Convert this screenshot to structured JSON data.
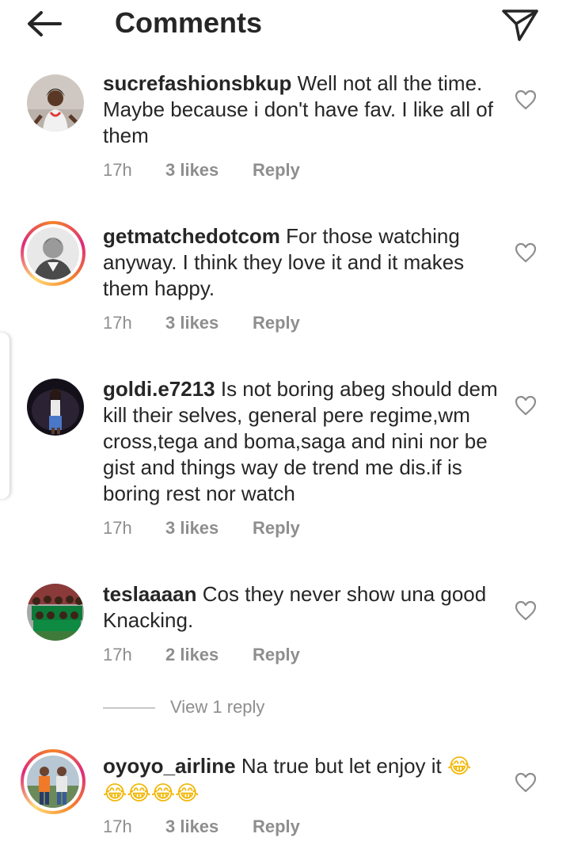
{
  "header": {
    "title": "Comments"
  },
  "comments": [
    {
      "username": "sucrefashionsbkup",
      "text": "Well not all the time. Maybe because i don't have fav. I like all of them",
      "time": "17h",
      "likes": "3 likes",
      "reply": "Reply",
      "story_ring": false
    },
    {
      "username": "getmatchedotcom",
      "text": "For those watching anyway. I think they love it and it makes them happy.",
      "time": "17h",
      "likes": "3 likes",
      "reply": "Reply",
      "story_ring": true
    },
    {
      "username": "goldi.e7213",
      "text": "Is not boring abeg should dem kill their selves, general pere regime,wm cross,tega and boma,saga and nini nor be gist and things way de trend me dis.if is boring rest nor watch",
      "time": "17h",
      "likes": "3 likes",
      "reply": "Reply",
      "story_ring": false
    },
    {
      "username": "teslaaaan",
      "text": "Cos they never show una good Knacking.",
      "time": "17h",
      "likes": "2 likes",
      "reply": "Reply",
      "story_ring": false,
      "view_replies": "View 1 reply"
    },
    {
      "username": "oyoyo_airline",
      "text": "Na true but let enjoy it",
      "emoji_line_1": "😂",
      "emoji_line_2": "😂😂😂😂",
      "time": "17h",
      "likes": "3 likes",
      "reply": "Reply",
      "story_ring": true
    }
  ],
  "icons": {
    "back": "arrow-left-icon",
    "send": "paper-plane-icon",
    "like": "heart-outline-icon"
  },
  "colors": {
    "text": "#262626",
    "secondary": "#8e8e8e",
    "story_ring_start": "#f58529",
    "story_ring_end": "#dd2a7b"
  }
}
